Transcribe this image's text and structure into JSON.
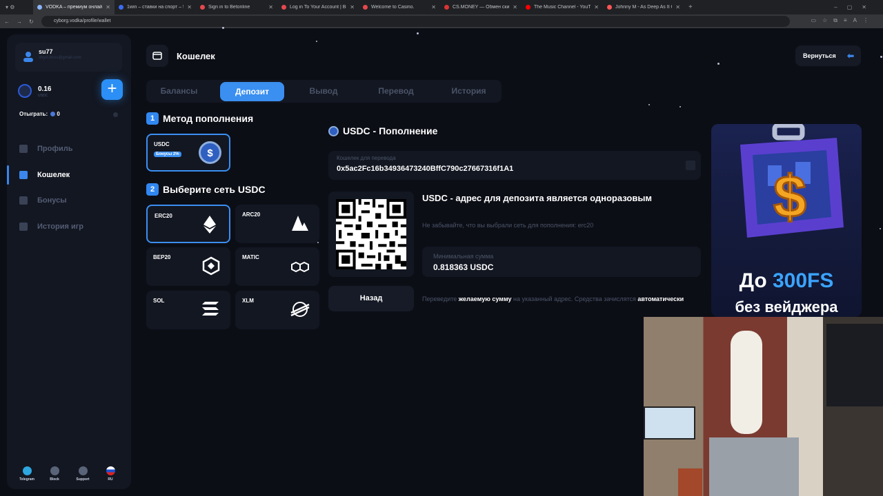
{
  "browser": {
    "tabs": [
      {
        "title": "VODKA – премиум онлайн-ка",
        "color": "#8ab4f8"
      },
      {
        "title": "1win – ставки на спорт – 5764",
        "color": "#3b6cf3"
      },
      {
        "title": "Sign in to Betonline",
        "color": "#e5484d"
      },
      {
        "title": "Log in To Your Account | BetO",
        "color": "#e5484d"
      },
      {
        "title": "Welcome to Casino.",
        "color": "#e5484d"
      },
      {
        "title": "CS.MONEY — Обмен скинов С",
        "color": "#d33"
      },
      {
        "title": "The Music Channel - YouTube",
        "color": "#ff0000"
      },
      {
        "title": "Johnny M - As Deep As It G",
        "color": "#ff5555"
      }
    ],
    "url": "cyborg.vodka/profile/wallet"
  },
  "sidebar": {
    "user": {
      "name": "su77",
      "email": "stryvl.boss@gmail.com"
    },
    "balance": {
      "value": "0.16",
      "currency": "USDC"
    },
    "wager": {
      "label": "Отыграть:",
      "value": "0"
    },
    "nav": [
      {
        "label": "Профиль",
        "active": false
      },
      {
        "label": "Кошелек",
        "active": true
      },
      {
        "label": "Бонусы",
        "active": false
      },
      {
        "label": "История игр",
        "active": false
      }
    ],
    "social": [
      {
        "label": "Telegram",
        "color": "#2ea6df"
      },
      {
        "label": "Block",
        "color": "#5a6478"
      },
      {
        "label": "Support",
        "color": "#5a6478"
      },
      {
        "label": "RU",
        "color": "#d22"
      }
    ]
  },
  "header": {
    "title": "Кошелек",
    "back_label": "Вернуться"
  },
  "tabs": [
    "Балансы",
    "Депозит",
    "Вывод",
    "Перевод",
    "История"
  ],
  "active_tab": "Депозит",
  "method": {
    "step1_num": "1",
    "step1_title": "Метод пополнения",
    "card_name": "USDC",
    "card_bonus": "Бонусы 2%",
    "step2_num": "2",
    "step2_title": "Выберите сеть USDC"
  },
  "networks": [
    "ERC20",
    "ARC20",
    "BEP20",
    "MATIC",
    "SOL",
    "XLM"
  ],
  "selected_network": "ERC20",
  "deposit": {
    "title": "USDC - Пополнение",
    "address_label": "Кошелек для перевода",
    "address": "0x5ac2Fc16b34936473240BffC790c27667316f1A1",
    "warn_title": "USDC - адрес для депозита является одноразовым",
    "warn_sub": "Не забывайте, что вы выбрали сеть для пополнения: erc20",
    "min_label": "Минимальная сумма",
    "min_value": "0.818363 USDC",
    "back_label": "Назад",
    "hint_pre": "Переведите ",
    "hint_b1": "желаемую сумму",
    "hint_mid": " на указанный адрес. Средства зачислятся ",
    "hint_b2": "автоматически"
  },
  "promo": {
    "line1_pre": "До ",
    "line1_accent": "300FS",
    "line2": "без вейджера"
  },
  "colors": {
    "accent": "#3b8ff2",
    "bg": "#0c0e16",
    "card": "#131722"
  }
}
